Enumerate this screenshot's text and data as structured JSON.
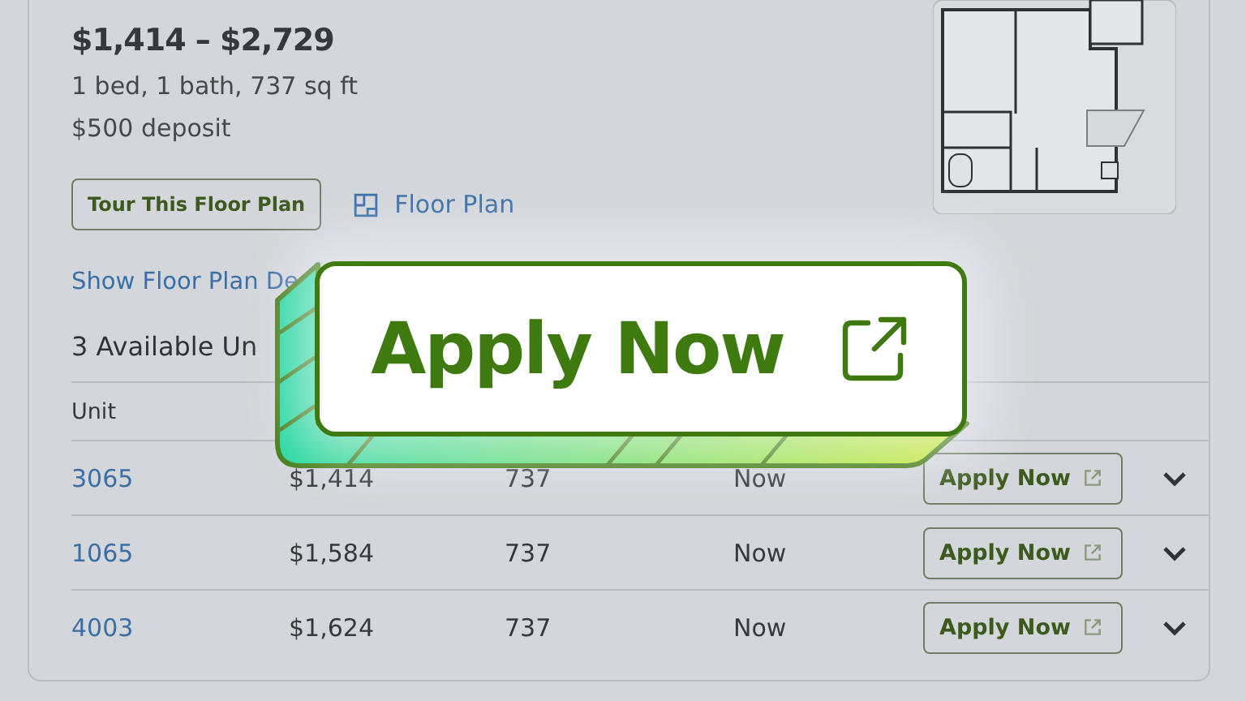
{
  "listing": {
    "price": "$1,414 – $2,729",
    "details": "1 bed, 1 bath, 737 sq ft",
    "deposit": "$500 deposit",
    "tour_button": "Tour This Floor Plan",
    "floor_plan_link": "Floor Plan",
    "details_link": "Show Floor Plan De",
    "units_heading": "3 Available Un"
  },
  "table": {
    "columns": [
      "Unit"
    ],
    "rows": [
      {
        "unit": "3065",
        "price": "$1,414",
        "sqft": "737",
        "available": "Now",
        "action": "Apply Now",
        "expanded": false
      },
      {
        "unit": "1065",
        "price": "$1,584",
        "sqft": "737",
        "available": "Now",
        "action": "Apply Now",
        "expanded": false
      },
      {
        "unit": "4003",
        "price": "$1,624",
        "sqft": "737",
        "available": "Now",
        "action": "Apply Now",
        "expanded": false
      }
    ]
  },
  "overlay": {
    "label": "Apply Now"
  }
}
